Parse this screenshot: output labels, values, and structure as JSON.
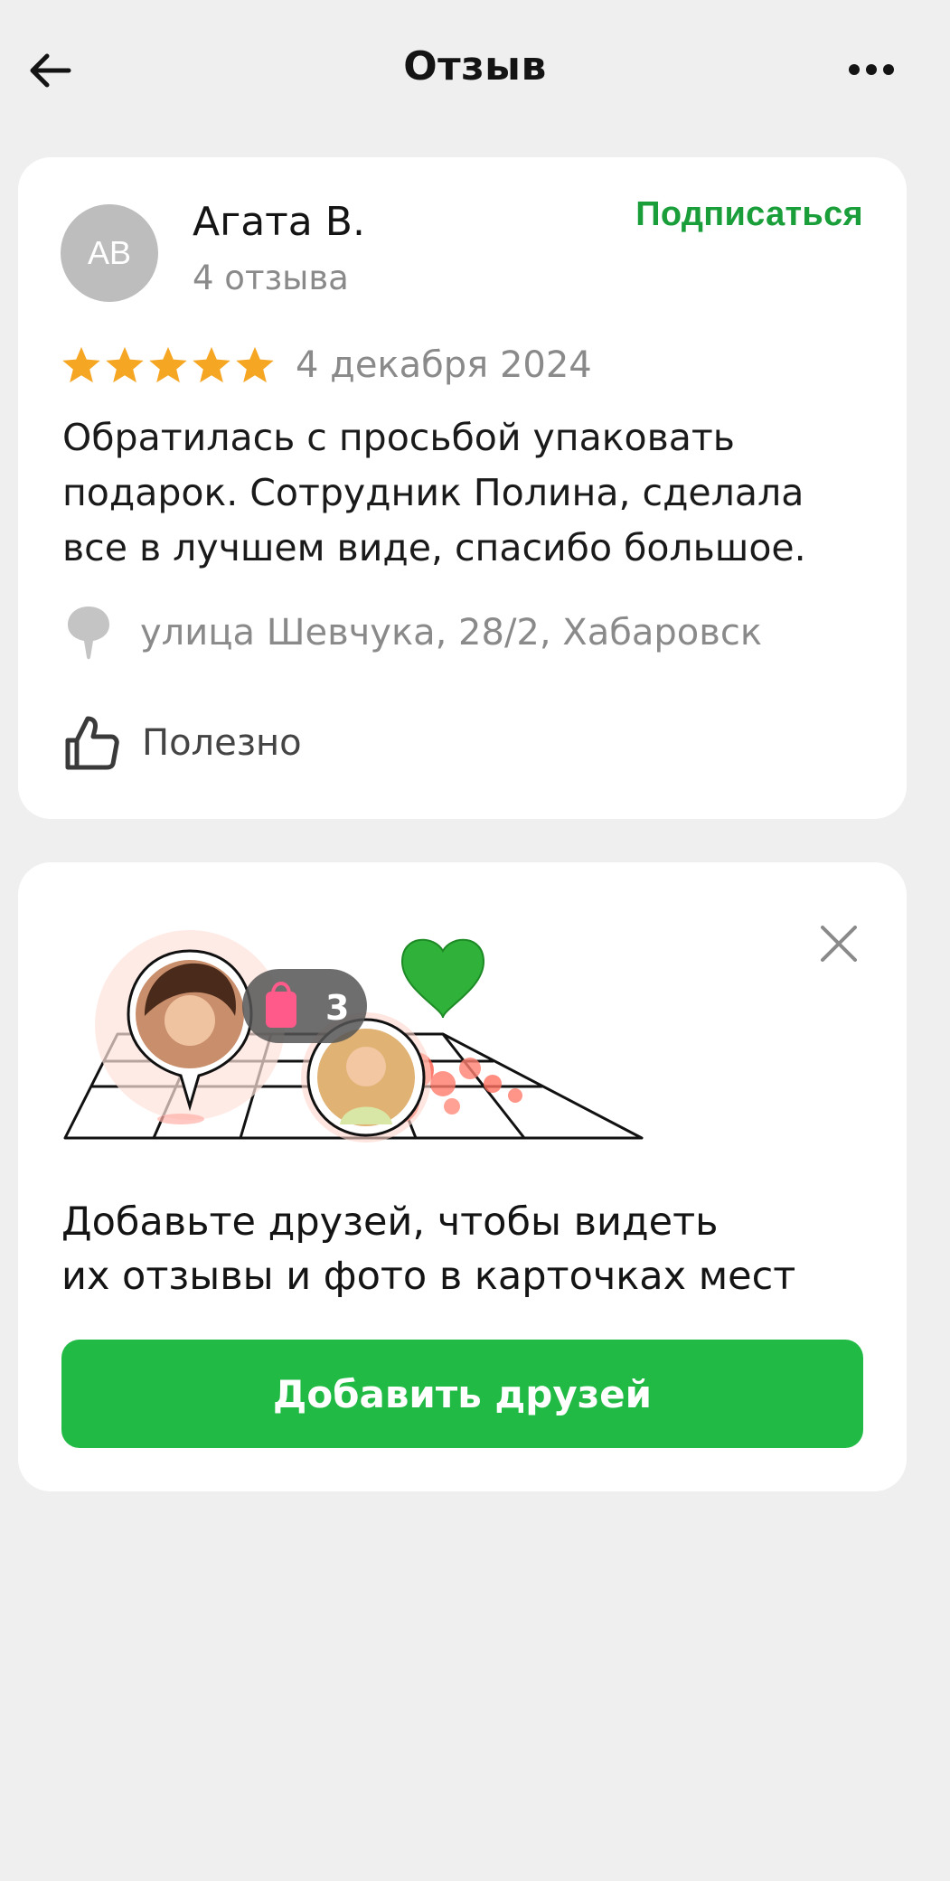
{
  "header": {
    "title": "Отзыв",
    "back_icon": "arrow-left-icon",
    "more_icon": "more-horizontal-icon"
  },
  "review": {
    "avatar_initials": "AB",
    "author_name": "Агата В.",
    "author_reviews_count": "4 отзыва",
    "subscribe_label": "Подписаться",
    "rating": 5,
    "rating_max": 5,
    "date": "4 декабря 2024",
    "text": "Обратилась с просьбой упаковать подарок. Сотрудник Полина, сделала все в лучшем виде, спасибо большое.",
    "address": "улица Шевчука, 28/2, Хабаровск",
    "useful_label": "Полезно"
  },
  "promo": {
    "badge_count": "3",
    "text_line1": "Добавьте друзей, чтобы видеть",
    "text_line2": "их отзывы и фото в карточках мест",
    "button_label": "Добавить друзей"
  },
  "colors": {
    "background": "#efefef",
    "card": "#ffffff",
    "accent_green": "#21ba45",
    "subscribe_green": "#1a9e3a",
    "star": "#f5a623",
    "muted_text": "#8a8a8a"
  }
}
